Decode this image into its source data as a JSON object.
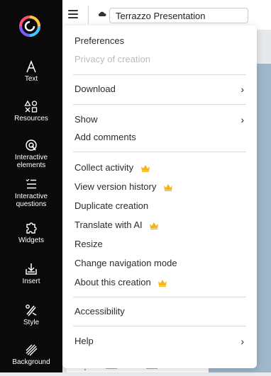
{
  "app": {
    "title": "Terrazzo Presentation",
    "accent_color": "#f2b51b"
  },
  "sidebar": {
    "items": [
      {
        "label": "Text",
        "icon": "text-icon"
      },
      {
        "label": "Resources",
        "icon": "resources-icon"
      },
      {
        "label": "Interactive\nelements",
        "icon": "interactive-elements-icon"
      },
      {
        "label": "Interactive\nquestions",
        "icon": "interactive-questions-icon"
      },
      {
        "label": "Widgets",
        "icon": "widgets-icon"
      },
      {
        "label": "Insert",
        "icon": "insert-icon"
      },
      {
        "label": "Style",
        "icon": "style-icon"
      },
      {
        "label": "Background",
        "icon": "background-icon"
      }
    ]
  },
  "menu": {
    "items": [
      {
        "label": "Preferences",
        "enabled": true
      },
      {
        "label": "Privacy of creation",
        "enabled": false
      },
      {
        "label": "Download",
        "submenu": true
      },
      {
        "label": "Show",
        "submenu": true
      },
      {
        "label": "Add comments"
      },
      {
        "label": "Collect activity",
        "premium": true
      },
      {
        "label": "View version history",
        "premium": true
      },
      {
        "label": "Duplicate creation"
      },
      {
        "label": "Translate with AI",
        "premium": true
      },
      {
        "label": "Resize"
      },
      {
        "label": "Change navigation mode"
      },
      {
        "label": "About this creation",
        "premium": true
      },
      {
        "label": "Accessibility"
      },
      {
        "label": "Help",
        "submenu": true
      }
    ],
    "chevron": "›"
  }
}
